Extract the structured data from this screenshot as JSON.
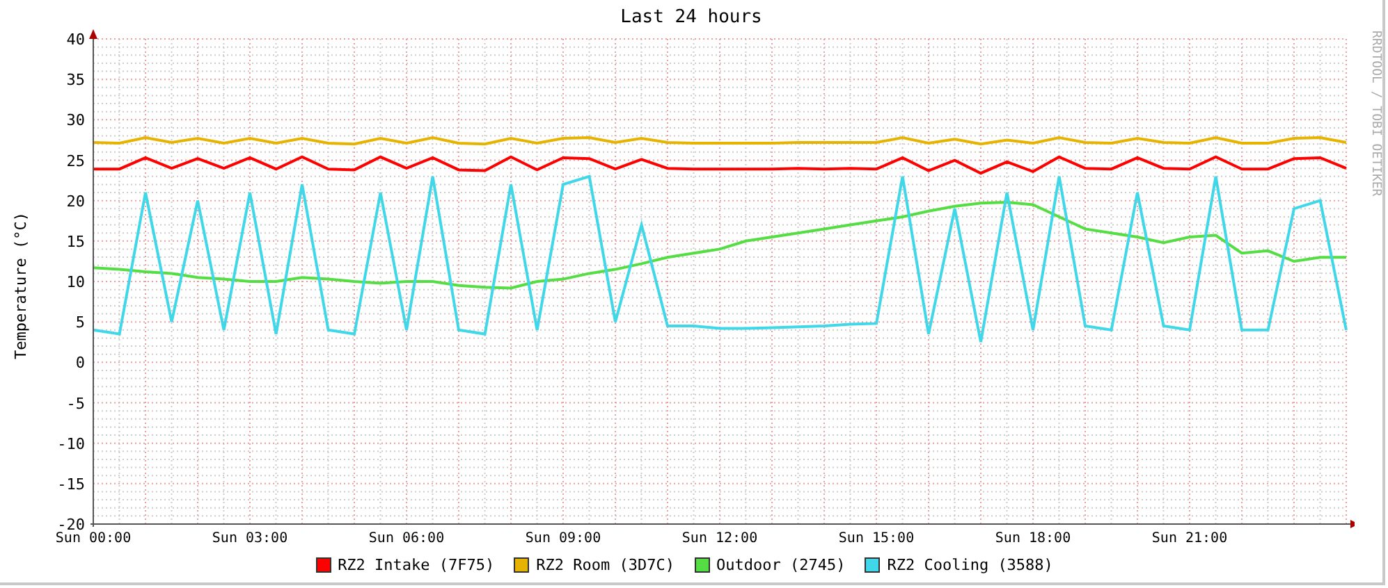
{
  "title": "Last 24 hours",
  "credit": "RRDTOOL / TOBI OETIKER",
  "chart_data": {
    "type": "line",
    "ylabel": "Temperature (°C)",
    "categories": [
      "Sun 00:00",
      null,
      null,
      null,
      null,
      null,
      "Sun 03:00",
      null,
      null,
      null,
      null,
      null,
      "Sun 06:00",
      null,
      null,
      null,
      null,
      null,
      "Sun 09:00",
      null,
      null,
      null,
      null,
      null,
      "Sun 12:00",
      null,
      null,
      null,
      null,
      null,
      "Sun 15:00",
      null,
      null,
      null,
      null,
      null,
      "Sun 18:00",
      null,
      null,
      null,
      null,
      null,
      "Sun 21:00",
      null,
      null,
      null,
      null,
      null,
      null
    ],
    "ylim": [
      -20,
      40
    ],
    "grid": true,
    "yticks": [
      -20,
      -15,
      -10,
      -5,
      0,
      5,
      10,
      15,
      20,
      25,
      30,
      35,
      40
    ],
    "series": [
      {
        "name": "RZ2 Intake (7F75)",
        "color": "#ff0000",
        "values": [
          23.9,
          23.9,
          25.3,
          24,
          25.2,
          24,
          25.3,
          23.9,
          25.4,
          23.9,
          23.8,
          25.4,
          24,
          25.3,
          23.8,
          23.7,
          25.4,
          23.8,
          25.3,
          25.2,
          23.9,
          25.1,
          24,
          23.9,
          23.9,
          23.9,
          23.9,
          24,
          23.9,
          24,
          23.9,
          25.3,
          23.7,
          25,
          23.4,
          24.8,
          23.6,
          25.4,
          24,
          23.9,
          25.3,
          24,
          23.9,
          25.4,
          23.9,
          23.9,
          25.2,
          25.3,
          24
        ]
      },
      {
        "name": "RZ2 Room (3D7C)",
        "color": "#e6b400",
        "values": [
          27.2,
          27.1,
          27.8,
          27.2,
          27.7,
          27.1,
          27.7,
          27.1,
          27.7,
          27.1,
          27,
          27.7,
          27.1,
          27.8,
          27.1,
          27,
          27.7,
          27.1,
          27.7,
          27.8,
          27.2,
          27.7,
          27.2,
          27.1,
          27.1,
          27.1,
          27.1,
          27.2,
          27.2,
          27.2,
          27.2,
          27.8,
          27.1,
          27.6,
          27,
          27.5,
          27.1,
          27.8,
          27.2,
          27.1,
          27.7,
          27.2,
          27.1,
          27.8,
          27.1,
          27.1,
          27.7,
          27.8,
          27.2
        ]
      },
      {
        "name": "Outdoor (2745)",
        "color": "#55dd44",
        "values": [
          11.7,
          11.5,
          11.2,
          11,
          10.5,
          10.3,
          10,
          10,
          10.5,
          10.3,
          10,
          9.8,
          10,
          10,
          9.5,
          9.3,
          9.2,
          10,
          10.3,
          11,
          11.5,
          12.2,
          13,
          13.5,
          14,
          15,
          15.5,
          16,
          16.5,
          17,
          17.5,
          18,
          18.7,
          19.3,
          19.7,
          19.8,
          19.5,
          18,
          16.5,
          16,
          15.5,
          14.8,
          15.5,
          15.7,
          13.5,
          13.8,
          12.5,
          13,
          13
        ]
      },
      {
        "name": "RZ2 Cooling (3588)",
        "color": "#40d8e8",
        "values": [
          4,
          3.5,
          21,
          5,
          20,
          4,
          21,
          3.5,
          22,
          4,
          3.5,
          21,
          4,
          23,
          4,
          3.5,
          22,
          4,
          22,
          23,
          5,
          17,
          4.5,
          4.5,
          4.2,
          4.2,
          4.3,
          4.4,
          4.5,
          4.7,
          4.8,
          23,
          3.5,
          19,
          2.5,
          21,
          4,
          23,
          4.5,
          4,
          21,
          4.5,
          4,
          23,
          4,
          4,
          19,
          20,
          4
        ]
      }
    ]
  }
}
